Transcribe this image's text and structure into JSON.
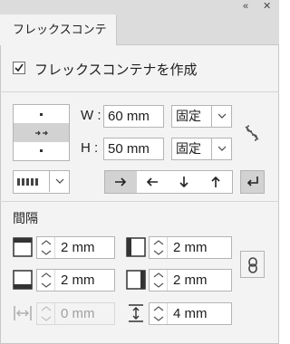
{
  "window": {
    "collapse_glyph": "«",
    "close_glyph": "✕"
  },
  "tab": {
    "label": "フレックスコンテナ"
  },
  "flex_container": {
    "checked": true,
    "label": "フレックスコンテナを作成"
  },
  "size": {
    "width_label": "W :",
    "width_value": "60 mm",
    "width_mode": "固定",
    "height_label": "H :",
    "height_value": "50 mm",
    "height_mode": "固定"
  },
  "direction": {
    "options": [
      "row",
      "row-reverse",
      "column",
      "column-reverse"
    ],
    "selected": "row"
  },
  "gap": {
    "heading": "間隔",
    "top": "2 mm",
    "left": "2 mm",
    "bottom": "2 mm",
    "right": "2 mm",
    "horizontal": "0 mm",
    "vertical": "4 mm"
  },
  "colors": {
    "panel": "#f3f3f3",
    "chrome": "#dcdcdc",
    "active": "#d2d2d2",
    "border": "#b4b4b4"
  }
}
